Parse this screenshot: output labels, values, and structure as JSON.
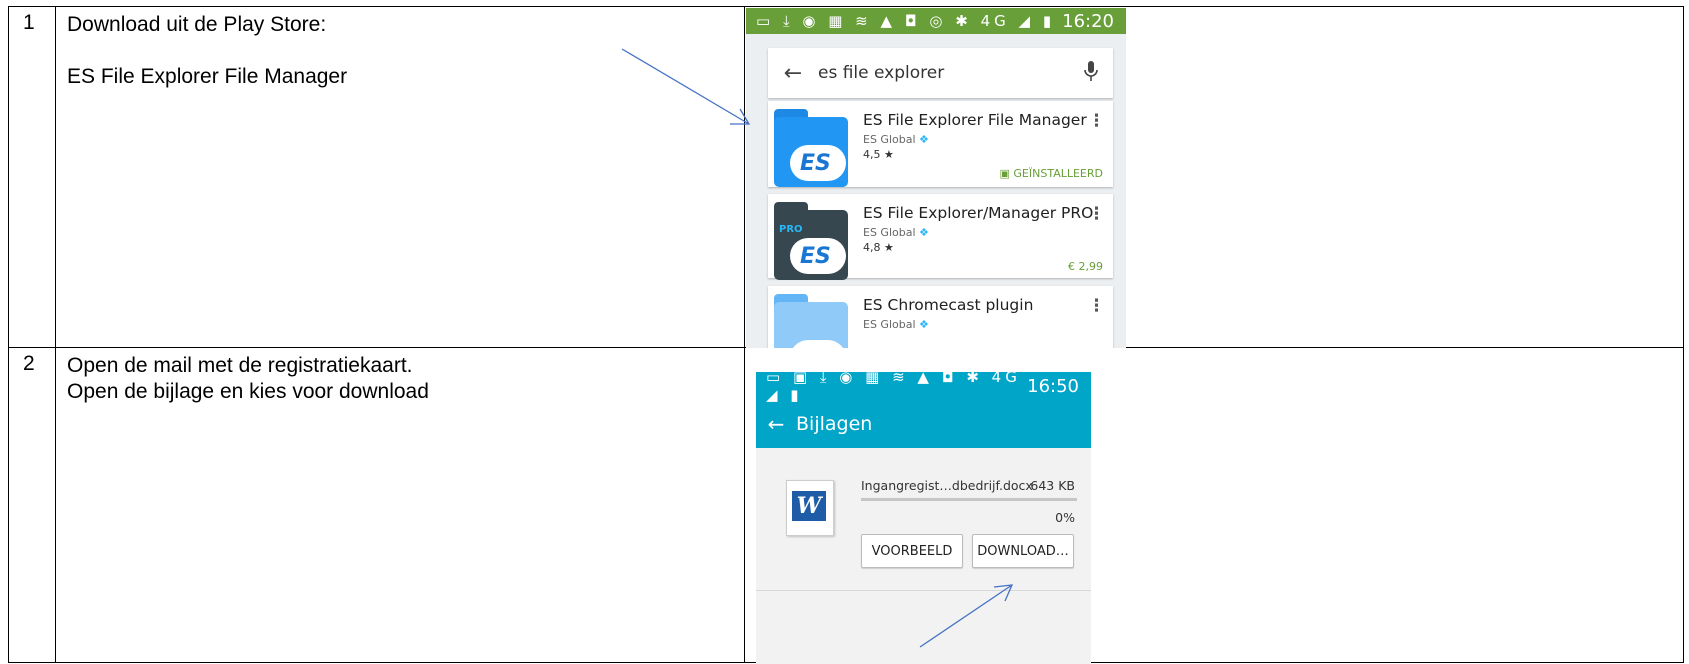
{
  "rows": [
    {
      "number": "1",
      "text_lines": [
        "Download uit de Play Store:",
        "",
        "ES File Explorer File Manager"
      ],
      "screenshot": {
        "status_time": "16:20",
        "status_icons": "▭ ⤓ ◉ ▦ ≋ ▲ ◘ ◎   ✱ 4G ◢ ▮",
        "search_query": "es file explorer",
        "back_icon": "arrow-left-icon",
        "mic_icon": "microphone-icon",
        "results": [
          {
            "title": "ES File Explorer File Manager",
            "developer": "ES Global",
            "rating": "4,5 ★",
            "status": "GEÏNSTALLEERD",
            "icon": "es-file-explorer-icon"
          },
          {
            "title": "ES File Explorer/Manager PRO",
            "developer": "ES Global",
            "rating": "4,8 ★",
            "status": "€ 2,99",
            "icon": "es-file-explorer-pro-icon"
          },
          {
            "title": "ES Chromecast plugin",
            "developer": "ES Global",
            "icon": "es-chromecast-icon"
          }
        ]
      }
    },
    {
      "number": "2",
      "text_lines": [
        "Open de mail met de registratiekaart.",
        "Open de bijlage en kies voor download"
      ],
      "screenshot": {
        "status_time": "16:50",
        "status_icons": "▭ ▣ ⤓ ◉ ▦ ≋ ▲ ◘   ✱ 4G ◢ ▮",
        "header_title": "Bijlagen",
        "file_name": "Ingangregist…dbedrijf.docx",
        "file_size": "643 KB",
        "progress_percent": "0%",
        "progress_fraction": 0.0,
        "buttons": [
          "VOORBEELD",
          "DOWNLOAD…"
        ]
      }
    }
  ],
  "colors": {
    "playstore_green": "#689f38",
    "email_teal": "#00a5c8",
    "arrow_blue": "#4472c4"
  }
}
